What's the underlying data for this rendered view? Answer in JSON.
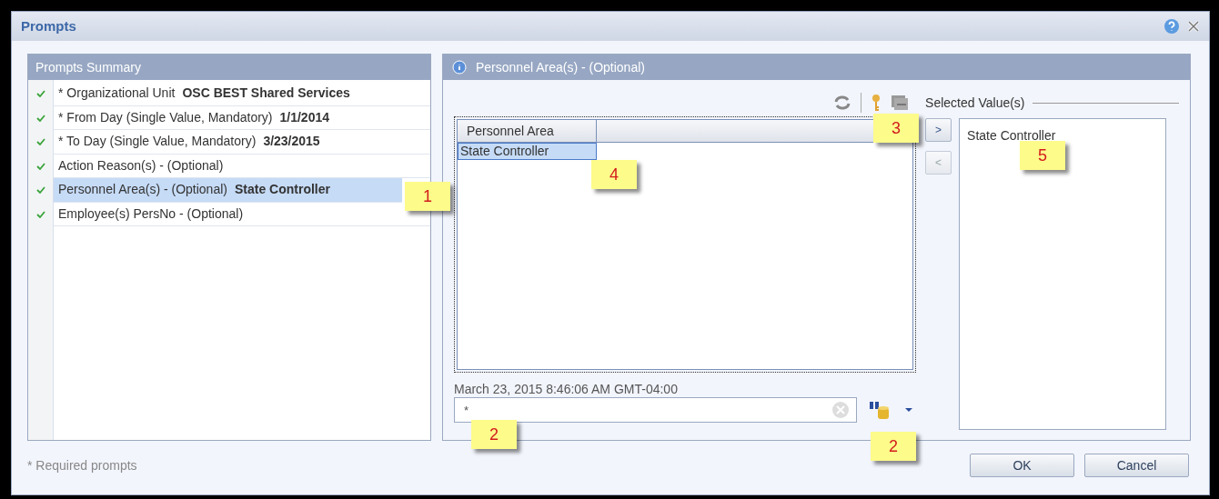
{
  "window": {
    "title": "Prompts"
  },
  "summary": {
    "title": "Prompts Summary",
    "items": [
      {
        "label": "* Organizational Unit",
        "value": "OSC BEST Shared Services",
        "checked": true,
        "selected": false
      },
      {
        "label": "* From Day (Single Value, Mandatory)",
        "value": "1/1/2014",
        "checked": true,
        "selected": false
      },
      {
        "label": "* To Day (Single Value, Mandatory)",
        "value": "3/23/2015",
        "checked": true,
        "selected": false
      },
      {
        "label": "Action Reason(s) - (Optional)",
        "checked": true,
        "selected": false
      },
      {
        "label": "Personnel Area(s) - (Optional)",
        "value": "State Controller",
        "checked": true,
        "selected": true
      },
      {
        "label": "Employee(s) PersNo - (Optional)",
        "checked": true,
        "selected": false
      }
    ]
  },
  "required_note": "* Required prompts",
  "prompt_panel": {
    "title": "Personnel Area(s) - (Optional)",
    "table": {
      "columns": [
        "Personnel Area"
      ],
      "rows": [
        {
          "cells": [
            "State Controller"
          ],
          "selected": true
        }
      ]
    },
    "timestamp": "March 23, 2015 8:46:06 AM GMT-04:00",
    "search": {
      "value": "*"
    },
    "add_button": ">",
    "remove_button": "<",
    "selected_title": "Selected Value(s)",
    "selected_values": [
      "State Controller"
    ]
  },
  "buttons": [
    "OK",
    "Cancel"
  ],
  "callouts": [
    {
      "label": "1",
      "kind": "c1"
    },
    {
      "label": "2",
      "kind": "c2a"
    },
    {
      "label": "2",
      "kind": "c2b"
    },
    {
      "label": "3",
      "kind": "c3"
    },
    {
      "label": "4",
      "kind": "c4"
    },
    {
      "label": "5",
      "kind": "c5"
    }
  ]
}
